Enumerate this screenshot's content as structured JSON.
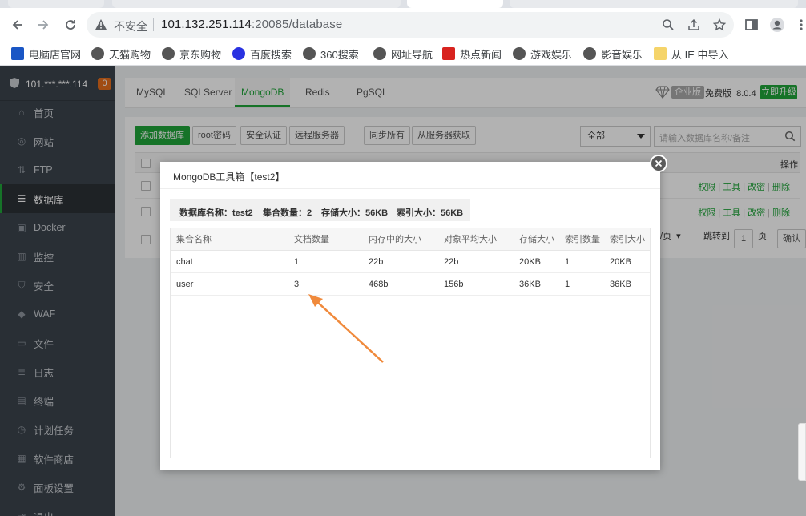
{
  "browser": {
    "insecure_label": "不安全",
    "url_host": "101.132.251.114",
    "url_path": ":20085/database"
  },
  "bookmarks": [
    {
      "label": "电脑店官网",
      "color": "#1a56c5"
    },
    {
      "label": "天猫购物",
      "color": "#555555"
    },
    {
      "label": "京东购物",
      "color": "#555555"
    },
    {
      "label": "百度搜索",
      "color": "#2932e1"
    },
    {
      "label": "360搜索",
      "color": "#555555"
    },
    {
      "label": "网址导航",
      "color": "#555555"
    },
    {
      "label": "热点新闻",
      "color": "#d8231f"
    },
    {
      "label": "游戏娱乐",
      "color": "#555555"
    },
    {
      "label": "影音娱乐",
      "color": "#555555"
    },
    {
      "label": "从 IE 中导入",
      "color": "#f5d46a"
    }
  ],
  "sidebar": {
    "server_ip": "101.***.***.114",
    "badge": "0",
    "items": [
      {
        "label": "首页",
        "icon": "home-icon"
      },
      {
        "label": "网站",
        "icon": "globe-icon"
      },
      {
        "label": "FTP",
        "icon": "ftp-icon"
      },
      {
        "label": "数据库",
        "icon": "database-icon",
        "active": true
      },
      {
        "label": "Docker",
        "icon": "docker-icon"
      },
      {
        "label": "监控",
        "icon": "monitor-icon"
      },
      {
        "label": "安全",
        "icon": "shield-icon"
      },
      {
        "label": "WAF",
        "icon": "waf-icon"
      },
      {
        "label": "文件",
        "icon": "folder-icon"
      },
      {
        "label": "日志",
        "icon": "log-icon"
      },
      {
        "label": "终端",
        "icon": "terminal-icon"
      },
      {
        "label": "计划任务",
        "icon": "clock-icon"
      },
      {
        "label": "软件商店",
        "icon": "apps-icon"
      },
      {
        "label": "面板设置",
        "icon": "settings-icon"
      },
      {
        "label": "退出",
        "icon": "logout-icon"
      }
    ]
  },
  "db_tabs": [
    "MySQL",
    "SQLServer",
    "MongoDB",
    "Redis",
    "PgSQL"
  ],
  "edition": {
    "enterprise": "企业版",
    "free": "免费版",
    "version": "8.0.4",
    "upgrade": "立即升级"
  },
  "actions": {
    "add_db": "添加数据库",
    "root_pwd": "root密码",
    "security": "安全认证",
    "remote": "远程服务器",
    "sync_all": "同步所有",
    "fetch": "从服务器获取",
    "filter_value": "全部",
    "search_placeholder": "请输入数据库名称/备注"
  },
  "bg_table": {
    "op_header": "操作",
    "row_links": [
      "权限",
      "工具",
      "改密",
      "删除"
    ],
    "pager_per_page": "/页",
    "pager_jump": "跳转到",
    "pager_page": "1",
    "pager_unit": "页",
    "pager_confirm": "确认"
  },
  "modal": {
    "title": "MongoDB工具箱【test2】",
    "summary": {
      "db_name_label": "数据库名称：",
      "db_name": "test2",
      "collections_label": "集合数量：",
      "collections": "2",
      "storage_label": "存储大小：",
      "storage": "56KB",
      "index_label": "索引大小：",
      "index": "56KB"
    },
    "columns": [
      "集合名称",
      "文档数量",
      "内存中的大小",
      "对象平均大小",
      "存储大小",
      "索引数量",
      "索引大小"
    ],
    "rows": [
      [
        "chat",
        "1",
        "22b",
        "22b",
        "20KB",
        "1",
        "20KB"
      ],
      [
        "user",
        "3",
        "468b",
        "156b",
        "36KB",
        "1",
        "36KB"
      ]
    ]
  },
  "colors": {
    "accent_green": "#20a53a",
    "sidebar_bg": "#3c444d",
    "annotation_arrow": "#f08a3c",
    "badge_orange": "#e66d1c"
  }
}
